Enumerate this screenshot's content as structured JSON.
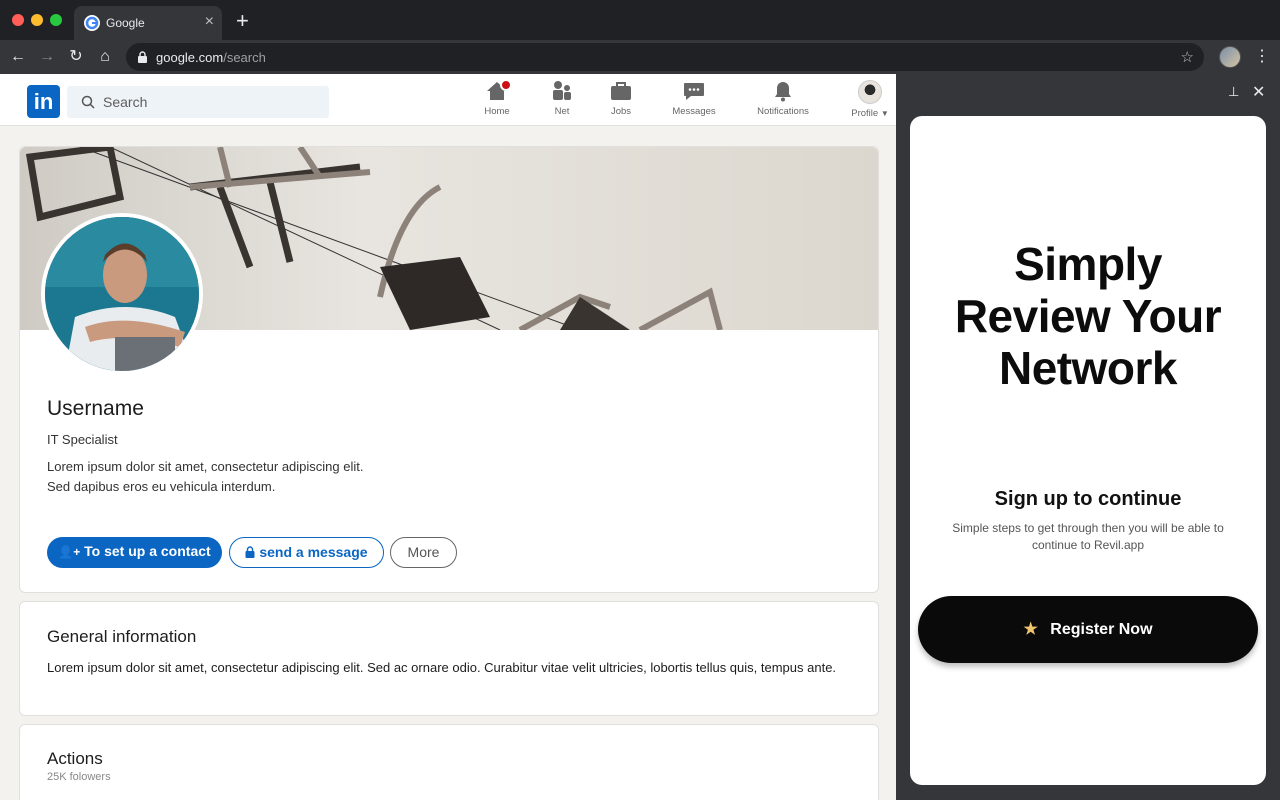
{
  "browser": {
    "tab_title": "Google",
    "tab_close": "×",
    "new_tab": "+",
    "url_host": "google.com",
    "url_path": "/search",
    "back": "←",
    "forward": "→",
    "reload": "↻",
    "home": "⌂",
    "star": "☆",
    "menu": "⋮"
  },
  "linkedin": {
    "logo": "in",
    "search_placeholder": "Search",
    "nav": [
      {
        "label": "Home",
        "icon": "home-icon"
      },
      {
        "label": "Net",
        "icon": "network-icon"
      },
      {
        "label": "Jobs",
        "icon": "briefcase-icon"
      },
      {
        "label": "Messages",
        "icon": "messages-icon"
      },
      {
        "label": "Notifications",
        "icon": "bell-icon"
      },
      {
        "label": "Profile",
        "icon": "avatar"
      }
    ],
    "profile": {
      "username": "Username",
      "headline": "IT Specialist",
      "bio_line1": "Lorem ipsum dolor sit amet, consectetur adipiscing elit.",
      "bio_line2": "Sed dapibus eros eu vehicula interdum.",
      "contact_button": "To set up a contact",
      "message_button": "send a message",
      "more_button": "More"
    },
    "general": {
      "title": "General information",
      "text": "Lorem ipsum dolor sit amet, consectetur adipiscing elit. Sed ac ornare odio. Curabitur vitae velit ultricies, lobortis tellus quis, tempus ante."
    },
    "actions": {
      "title": "Actions",
      "followers": "25K folowers"
    },
    "colors": {
      "brand": "#0a66c2",
      "badge": "#cc1016"
    }
  },
  "sidepanel": {
    "pin": "⊥",
    "close": "✕",
    "title_line1": "Simply",
    "title_line2": "Review Your",
    "title_line3": "Network",
    "signup_title": "Sign up to continue",
    "signup_desc": "Simple steps to get through then you will be able to continue to Revil.app",
    "register_label": "Register Now"
  }
}
